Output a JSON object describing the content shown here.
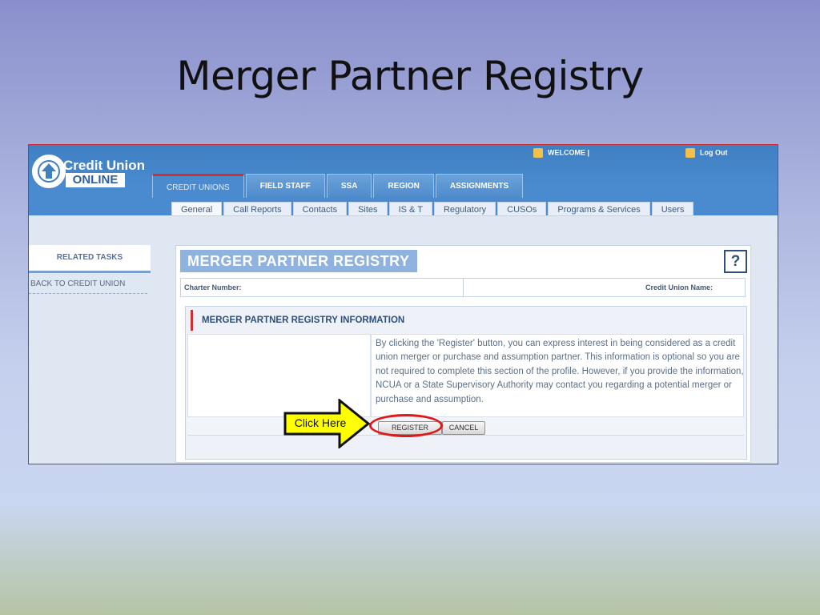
{
  "slide": {
    "title": "Merger Partner Registry"
  },
  "header": {
    "logo_line1": "Credit Union",
    "logo_line2": "ONLINE",
    "welcome": "WELCOME |",
    "logout": "Log Out"
  },
  "main_tabs": [
    {
      "label": "CREDIT UNIONS",
      "active": true
    },
    {
      "label": "FIELD STAFF",
      "active": false
    },
    {
      "label": "SSA",
      "active": false
    },
    {
      "label": "REGION",
      "active": false
    },
    {
      "label": "ASSIGNMENTS",
      "active": false
    }
  ],
  "sub_tabs": [
    {
      "label": "General",
      "active": true
    },
    {
      "label": "Call Reports",
      "active": false
    },
    {
      "label": "Contacts",
      "active": false
    },
    {
      "label": "Sites",
      "active": false
    },
    {
      "label": "IS & T",
      "active": false
    },
    {
      "label": "Regulatory",
      "active": false
    },
    {
      "label": "CUSOs",
      "active": false
    },
    {
      "label": "Programs & Services",
      "active": false
    },
    {
      "label": "Users",
      "active": false
    }
  ],
  "sidebar": {
    "heading": "RELATED TASKS",
    "link": "BACK TO CREDIT UNION"
  },
  "panel": {
    "title": "MERGER PARTNER REGISTRY",
    "help": "?",
    "charter_label": "Charter Number:",
    "cu_name_label": "Credit Union Name:"
  },
  "info": {
    "header": "MERGER PARTNER REGISTRY INFORMATION",
    "text": "By clicking the 'Register' button, you can express interest in being considered as a credit union merger or purchase and assumption partner. This information is optional so you are not required to complete this section of the profile. However, if you provide the information, NCUA or a State Supervisory Authority may contact you regarding a potential merger or purchase and assumption.",
    "register_label": "REGISTER",
    "cancel_label": "CANCEL"
  },
  "callout": {
    "text": "Click Here",
    "color": "#ffff00",
    "highlight_color": "#e01818"
  }
}
